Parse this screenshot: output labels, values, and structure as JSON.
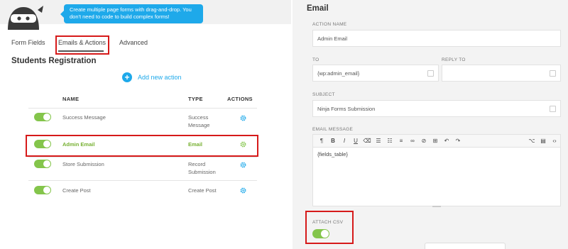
{
  "tooltip": "Create multiple page forms with drag-and-drop. You don't need to code to build complex forms!",
  "tabs": [
    "Form Fields",
    "Emails & Actions",
    "Advanced"
  ],
  "form_title": "Students Registration",
  "add_action_label": "Add new action",
  "table": {
    "headers": {
      "name": "NAME",
      "type": "TYPE",
      "actions": "ACTIONS"
    },
    "rows": [
      {
        "name": "Success Message",
        "type": "Success Message",
        "enabled": true
      },
      {
        "name": "Admin Email",
        "type": "Email",
        "enabled": true,
        "highlighted": true
      },
      {
        "name": "Store Submission",
        "type": "Record Submission",
        "enabled": true
      },
      {
        "name": "Create Post",
        "type": "Create Post",
        "enabled": true
      }
    ]
  },
  "email_panel": {
    "title": "Email",
    "action_name_label": "ACTION NAME",
    "action_name_value": "Admin Email",
    "to_label": "TO",
    "to_value": "{wp:admin_email}",
    "reply_to_label": "REPLY TO",
    "reply_to_value": "",
    "subject_label": "SUBJECT",
    "subject_value": "Ninja Forms Submission",
    "message_label": "EMAIL MESSAGE",
    "message_value": "{fields_table}",
    "attach_csv_label": "ATTACH CSV",
    "attach_csv_enabled": true
  },
  "colors": {
    "accent_blue": "#1ea9ea",
    "toggle_green": "#84c54b",
    "highlight_red": "#d61a1a",
    "active_text_green": "#76b031"
  }
}
